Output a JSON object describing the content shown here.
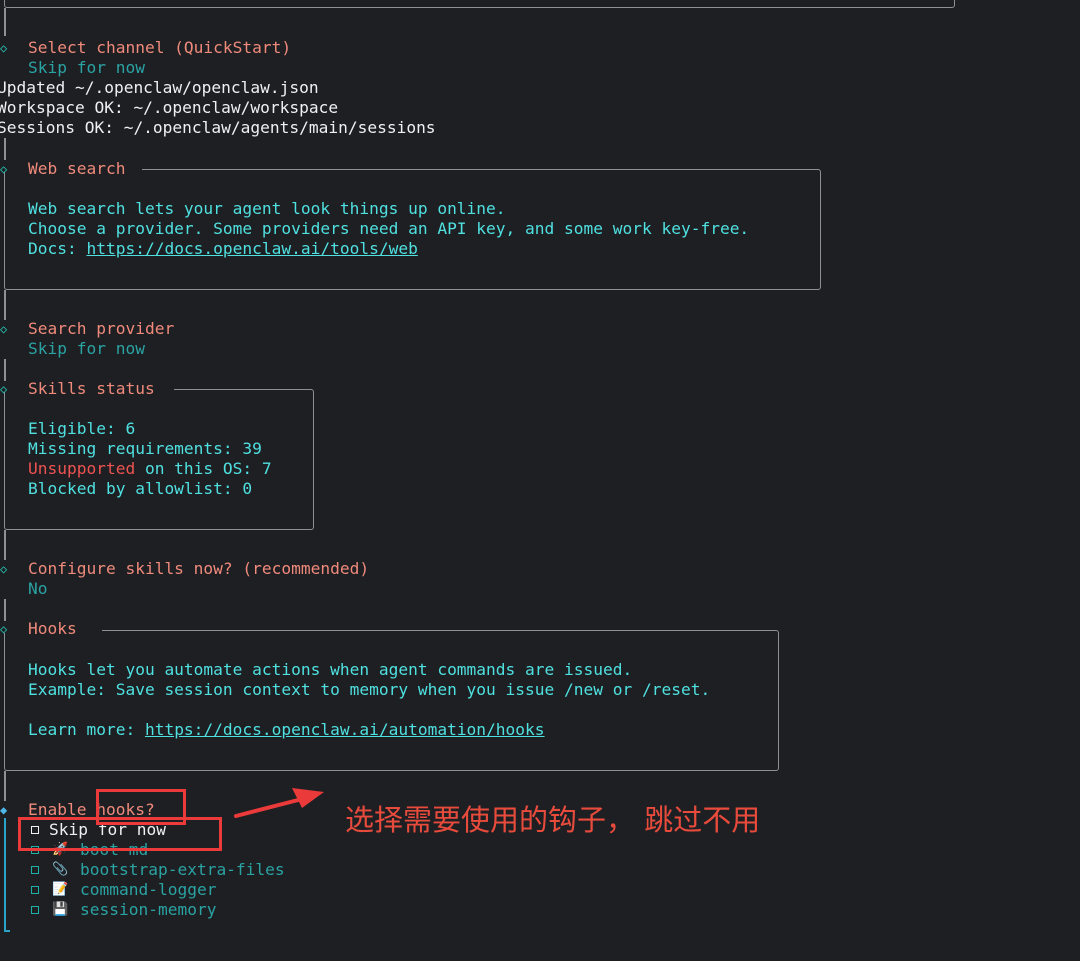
{
  "channel": {
    "title": "Select channel (QuickStart)",
    "value": "Skip for now"
  },
  "status_lines": [
    "Updated ~/.openclaw/openclaw.json",
    "Workspace OK: ~/.openclaw/workspace",
    "Sessions OK: ~/.openclaw/agents/main/sessions"
  ],
  "web_search": {
    "title": "Web search",
    "line1": "Web search lets your agent look things up online.",
    "line2": "Choose a provider. Some providers need an API key, and some work key-free.",
    "docs_label": "Docs: ",
    "docs_url": "https://docs.openclaw.ai/tools/web"
  },
  "search_provider": {
    "title": "Search provider",
    "value": "Skip for now"
  },
  "skills_status": {
    "title": "Skills status",
    "eligible": "Eligible: 6",
    "missing": "Missing requirements: 39",
    "unsupported_word": "Unsupported",
    "unsupported_rest": " on this OS: 7",
    "blocked": "Blocked by allowlist: 0"
  },
  "configure_skills": {
    "title": "Configure skills now? (recommended)",
    "value": "No"
  },
  "hooks": {
    "title": "Hooks",
    "line1": "Hooks let you automate actions when agent commands are issued.",
    "line2": "Example: Save session context to memory when you issue /new or /reset.",
    "learn_label": "Learn more: ",
    "learn_url": "https://docs.openclaw.ai/automation/hooks"
  },
  "enable_hooks": {
    "prompt": "Enable hooks?",
    "options": [
      {
        "label": "Skip for now",
        "icon": "",
        "selected": true
      },
      {
        "label": "boot-md",
        "icon": "rocket-icon",
        "selected": false
      },
      {
        "label": "bootstrap-extra-files",
        "icon": "paperclip-icon",
        "selected": false
      },
      {
        "label": "command-logger",
        "icon": "memo-icon",
        "selected": false
      },
      {
        "label": "session-memory",
        "icon": "floppy-disk-icon",
        "selected": false
      }
    ]
  },
  "annotation": "选择需要使用的钩子， 跳过不用",
  "colors": {
    "background": "#1e1f23",
    "accent_cyan": "#4fe0e0",
    "title_salmon": "#f08a7b",
    "annotation_red": "#e84b3c"
  }
}
